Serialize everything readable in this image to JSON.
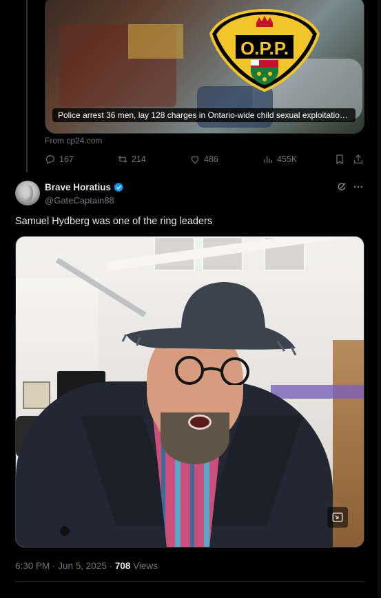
{
  "link_card": {
    "caption": "Police arrest 36 men, lay 128 charges in Ontario-wide child sexual exploitation...",
    "logo_text": "O.P.P.",
    "source_prefix": "From",
    "source_domain": "cp24.com"
  },
  "quoted_actions": {
    "replies": "167",
    "reposts": "214",
    "likes": "486",
    "views": "455K"
  },
  "tweet": {
    "author_name": "Brave Horatius",
    "handle": "@GateCaptain88",
    "text": "Samuel Hydberg was one of the ring leaders",
    "time": "6:30 PM · Jun 5, 2025 · ",
    "views_count": "708",
    "views_label": " Views"
  },
  "icons": {
    "reply": "reply-icon",
    "repost": "repost-icon",
    "like": "heart-icon",
    "views": "analytics-icon",
    "bookmark": "bookmark-icon",
    "share": "share-icon",
    "verified": "verified-badge-icon",
    "grok": "grok-icon",
    "more": "more-icon"
  },
  "colors": {
    "background": "#000000",
    "text": "#e7e9ea",
    "muted": "#71767b",
    "border": "#2f3336",
    "verified": "#1d9bf0",
    "opp_yellow": "#f2c52a"
  }
}
